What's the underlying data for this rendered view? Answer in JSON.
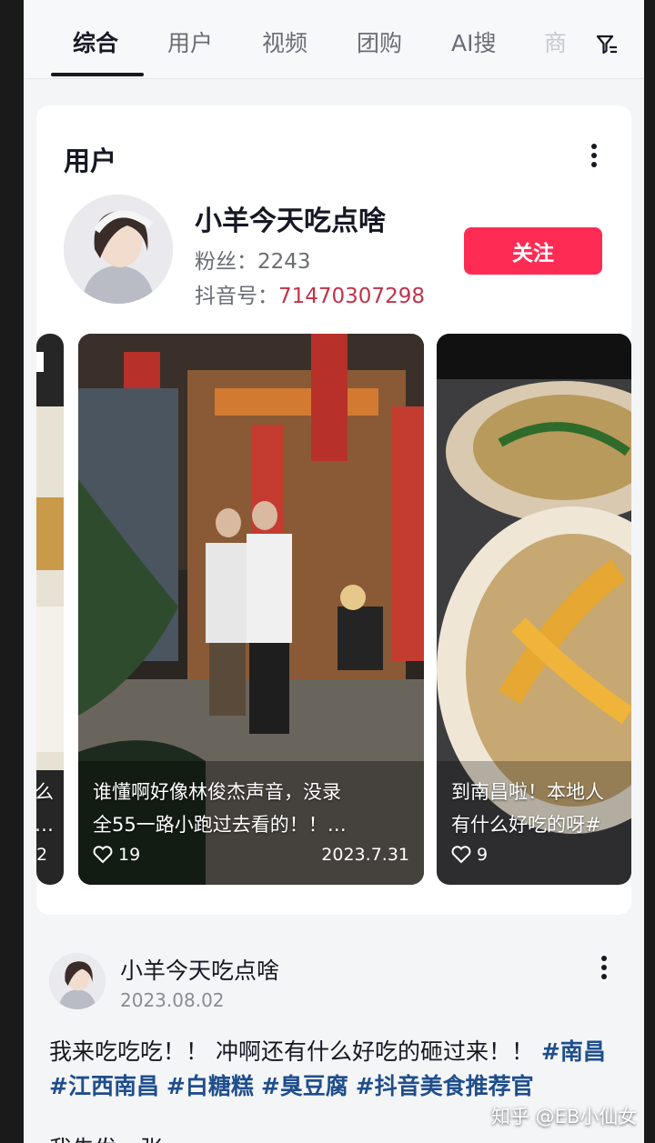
{
  "tabs": [
    {
      "label": "综合"
    },
    {
      "label": "用户"
    },
    {
      "label": "视频"
    },
    {
      "label": "团购"
    },
    {
      "label": "AI搜"
    },
    {
      "label": "商"
    }
  ],
  "user_section": {
    "title": "用户",
    "username": "小羊今天吃点啥",
    "fans_text": "粉丝：2243",
    "douyin_id_label": "抖音号：",
    "douyin_id_value": "71470307298",
    "follow_label": "关注"
  },
  "videos": [
    {
      "caption_line1": "么",
      "caption_line2": "…",
      "likes": "2"
    },
    {
      "caption_line1": "谁懂啊好像林俊杰声音，没录",
      "caption_line2": "全55一路小跑过去看的！！…",
      "likes": "19",
      "date": "2023.7.31"
    },
    {
      "caption_line1": "到南昌啦！本地人",
      "caption_line2": "有什么好吃的呀#",
      "likes": "9"
    }
  ],
  "post": {
    "author": "小羊今天吃点啥",
    "date": "2023.08.02",
    "text": "我来吃吃吃！！ 冲啊还有什么好吃的砸过来！！",
    "tags": [
      "#南昌",
      "#江西南昌",
      "#白糖糕",
      "#臭豆腐",
      "#抖音美食推荐官"
    ],
    "next_line": "我先发一张"
  },
  "watermark": "知乎 @EB小仙女",
  "colors": {
    "follow": "#fe2c55",
    "tag": "#1f4e8c",
    "id": "#c0334a"
  }
}
